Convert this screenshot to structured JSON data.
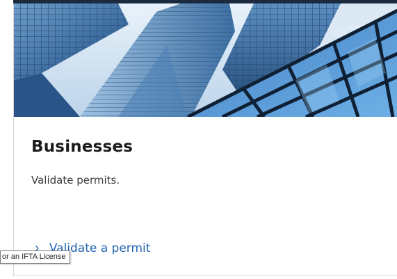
{
  "card": {
    "title": "Businesses",
    "description": "Validate permits.",
    "link_label": "Validate a permit",
    "link_icon": "chevron-right-icon",
    "hero_image": "glass-skyscrapers-image"
  },
  "tooltip": {
    "text": "or an IFTA License"
  },
  "colors": {
    "link": "#1f63b1",
    "title": "#1b1b1b",
    "body": "#3b3b3b",
    "border": "#d6d6d6",
    "top_edge": "#1c2a3f"
  }
}
